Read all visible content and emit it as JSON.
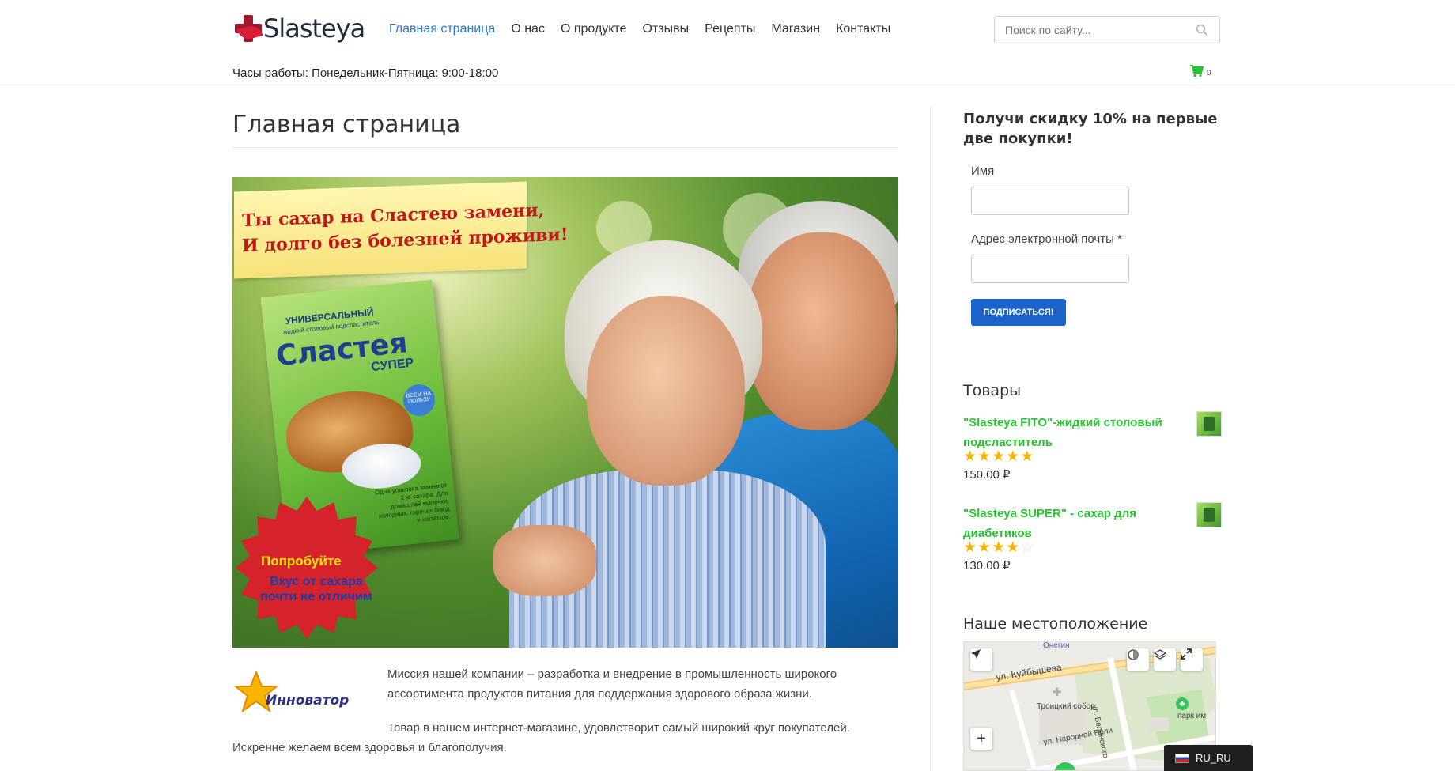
{
  "header": {
    "logo_text": "Slasteya",
    "nav": [
      {
        "label": "Главная страница",
        "active": true
      },
      {
        "label": "О нас"
      },
      {
        "label": "О продукте"
      },
      {
        "label": "Отзывы"
      },
      {
        "label": "Рецепты"
      },
      {
        "label": "Магазин"
      },
      {
        "label": "Контакты"
      }
    ],
    "search": {
      "placeholder": "Поиск по сайту..."
    },
    "hours": "Часы работы: Понедельник-Пятница: 9:00-18:00",
    "cart": {
      "count": "0",
      "icon": "cart-icon",
      "color": "#27c430"
    }
  },
  "main": {
    "title": "Главная страница",
    "hero": {
      "banner_line1": "Ты сахар на Сластею замени,",
      "banner_line2": "И долго без болезней проживи!",
      "package_top": "УНИВЕРСАЛЬНЫЙ",
      "package_sub": "жидкий столовый подсластитель",
      "package_name": "Сластея",
      "package_super": "СУПЕР",
      "package_circle": "ВСЕМ НА ПОЛЬЗУ",
      "package_side": "Одна упаковка заменяет 2 кг сахара. Для домашней выпечки, холодных, горячих блюд и напитков.",
      "burst_line1": "Попробуйте",
      "burst_line2": "Вкус от сахара почти не отличим"
    },
    "partner_logo_text": "Инноватор",
    "mission": "Миссия нашей компании – разработка и внедрение в промышленность широкого ассортимента продуктов питания для поддержания  здорового образа жизни.",
    "para2_line1": "Товар в нашем интернет-магазине, удовлетворит самый широкий круг покупателей.",
    "para2_line2": "Искренне желаем всем здоровья и благополучия."
  },
  "sidebar": {
    "promo_title": "Получи скидку 10% на первые две покупки!",
    "name_label": "Имя",
    "email_label": "Адрес электронной почты *",
    "subscribe_label": "ПОДПИСАТЬСЯ!",
    "products_title": "Товары",
    "products": [
      {
        "name": "\"Slasteya FITO\"-жидкий столовый подсластитель",
        "rating": 5,
        "price": "150.00 ₽"
      },
      {
        "name": "\"Slasteya SUPER\" - сахар для диабетиков",
        "rating": 4,
        "price": "130.00 ₽"
      }
    ],
    "location_title": "Наше местоположение",
    "map_labels": {
      "street1": "ул. Куйбышева",
      "street2": "ул. Белинского",
      "street3": "ул. Народной Воли",
      "poi1": "Троицкий собор",
      "poi2": "парк им.",
      "poi3": "Онегин"
    }
  },
  "language": "RU_RU",
  "colors": {
    "accent": "#2d7ac8",
    "product_link": "#27c430",
    "button": "#1a64c9",
    "star": "#f2b600"
  }
}
